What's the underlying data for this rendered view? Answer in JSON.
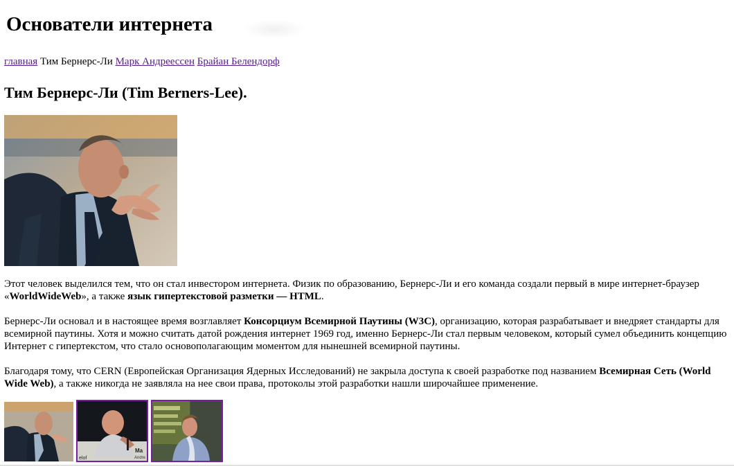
{
  "header": {
    "site_title": "Основатели интернета"
  },
  "nav": {
    "items": [
      {
        "label": "главная",
        "link": true
      },
      {
        "label": "Тим Бернерс-Ли",
        "link": false
      },
      {
        "label": "Марк Андреессен",
        "link": true
      },
      {
        "label": "Брайан Белендорф",
        "link": true
      }
    ]
  },
  "main": {
    "heading": "Тим Бернерс-Ли (Tim Berners-Lee).",
    "paragraphs": [
      {
        "before": "Этот человек выделился тем, что он стал инвестором интернета. Физик по образованию, Бернерс-Ли и его команда создали первый в мире интернет-браузер «",
        "bold1": "WorldWideWeb",
        "middle": "», а также ",
        "bold2": "язык гипертекстовой разметки — HTML",
        "after": "."
      },
      {
        "before": "Бернерс-Ли основал и в настоящее время возглавляет ",
        "bold1": "Консорциум Всемирной Паутины (W3C)",
        "after": ", организацию, которая разрабатывает и внедряет стандарты для всемирной паутины. Хотя и можно считать датой рождения интернет 1969 год, именно Бернерс-Ли стал первым человеком, который сумел объединить концепцию Интернет с гипертекстом, что стало основополагающим моментом для нынешней всемирной паутины."
      },
      {
        "before": "Благодаря тому, что CERN (Европейская Организация Ядерных Исследований) не закрыла доступа к своей разработке под названием ",
        "bold1": "Всемирная Сеть (World Wide Web)",
        "after": ", а также никогда не заявляла на нее свои права, протоколы этой разработки нашли широчайшее применение."
      }
    ]
  },
  "thumbnails": [
    {
      "name": "tim-berners-lee-thumbnail",
      "visited": false
    },
    {
      "name": "marc-andreessen-thumbnail",
      "visited": true,
      "caption_fragments": [
        "elof",
        "Ma",
        "Andre"
      ]
    },
    {
      "name": "brian-behlendorf-thumbnail",
      "visited": true
    }
  ],
  "colors": {
    "link": "#551a8b",
    "visited_border": "#7b1fa2",
    "text": "#000000",
    "background": "#ffffff"
  }
}
